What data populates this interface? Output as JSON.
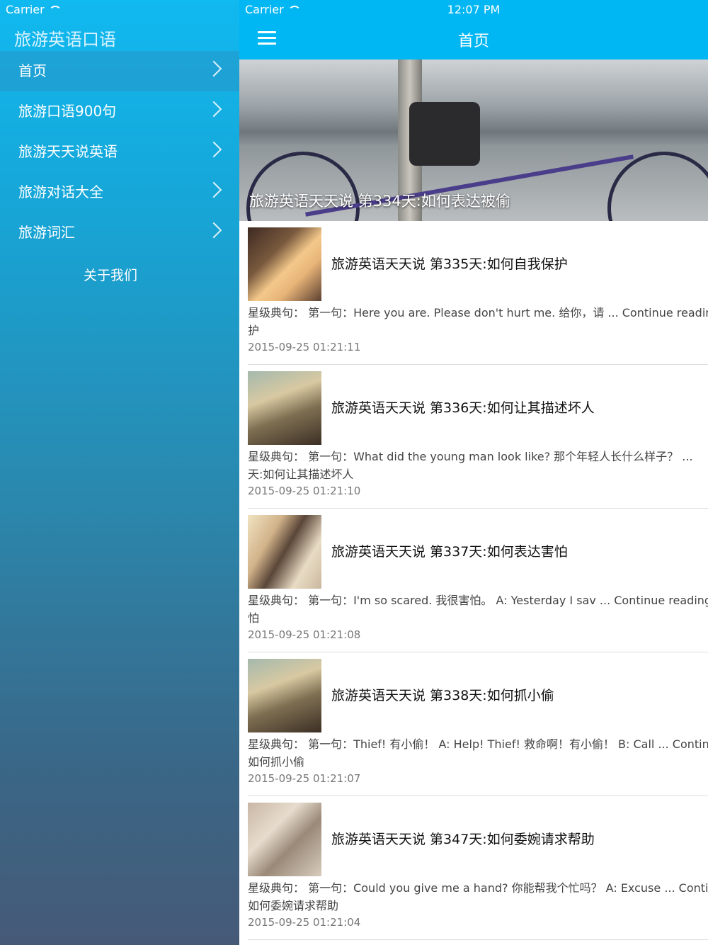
{
  "status": {
    "carrier": "Carrier",
    "time": "12:07 PM"
  },
  "sidebar": {
    "title": "旅游英语口语",
    "items": [
      {
        "label": "首页",
        "active": true
      },
      {
        "label": "旅游口语900句"
      },
      {
        "label": "旅游天天说英语"
      },
      {
        "label": "旅游对话大全"
      },
      {
        "label": "旅游词汇"
      }
    ],
    "about": "关于我们"
  },
  "navbar": {
    "title": "首页",
    "menu_icon": "hamburger-menu-icon"
  },
  "hero": {
    "caption": "旅游英语天天说 第334天:如何表达被偷"
  },
  "articles": [
    {
      "title": "旅游英语天天说 第335天:如何自我保护",
      "desc": "星级典句： 第一句：Here you are. Please don't hurt me. 给你，请 ... Continue reading",
      "desc2": "护",
      "date": "2015-09-25 01:21:11"
    },
    {
      "title": "旅游英语天天说 第336天:如何让其描述坏人",
      "desc": "星级典句： 第一句：What did the young man look like? 那个年轻人长什么样子？ ...",
      "desc2": "天:如何让其描述坏人",
      "date": "2015-09-25 01:21:10"
    },
    {
      "title": "旅游英语天天说 第337天:如何表达害怕",
      "desc": "星级典句： 第一句：I'm so scared. 我很害怕。 A: Yesterday I sav ... Continue reading",
      "desc2": "怕",
      "date": "2015-09-25 01:21:08"
    },
    {
      "title": "旅游英语天天说 第338天:如何抓小偷",
      "desc": "星级典句： 第一句：Thief! 有小偷！ A: Help! Thief! 救命啊！有小偷！ B: Call ... Continue",
      "desc2": "如何抓小偷",
      "date": "2015-09-25 01:21:07"
    },
    {
      "title": "旅游英语天天说 第347天:如何委婉请求帮助",
      "desc": "星级典句： 第一句：Could you give me a hand? 你能帮我个忙吗？ A: Excuse ... Continue",
      "desc2": "如何委婉请求帮助",
      "date": "2015-09-25 01:21:04"
    }
  ]
}
